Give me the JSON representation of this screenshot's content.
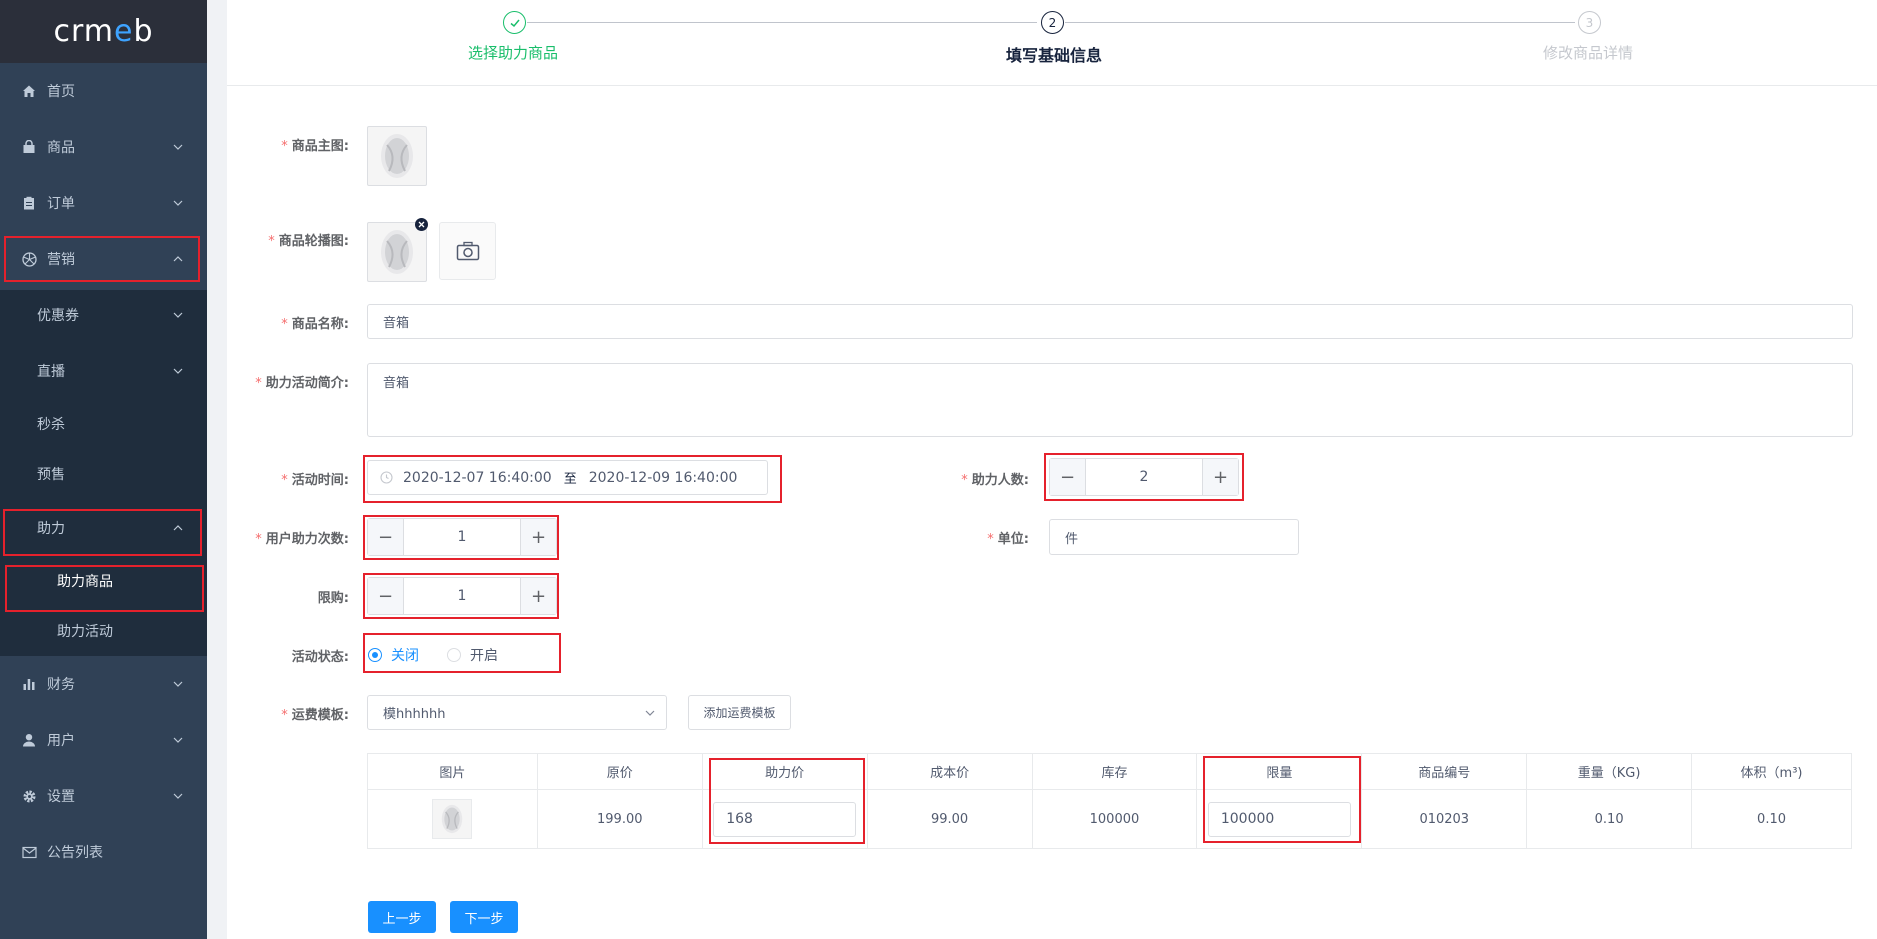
{
  "logo": {
    "pre": "crm",
    "e": "e",
    "post": "b"
  },
  "sidebar": {
    "items": [
      {
        "label": "首页",
        "icon": "home-icon"
      },
      {
        "label": "商品",
        "icon": "shopping-bag-icon"
      },
      {
        "label": "订单",
        "icon": "clipboard-icon"
      },
      {
        "label": "营销",
        "icon": "aperture-icon"
      },
      {
        "label": "财务",
        "icon": "bar-chart-icon"
      },
      {
        "label": "用户",
        "icon": "user-icon"
      },
      {
        "label": "设置",
        "icon": "gear-icon"
      },
      {
        "label": "公告列表",
        "icon": "mail-icon"
      }
    ],
    "marketing_sub": [
      {
        "label": "优惠券"
      },
      {
        "label": "直播"
      },
      {
        "label": "秒杀"
      },
      {
        "label": "预售"
      },
      {
        "label": "助力"
      }
    ],
    "assist_sub": [
      {
        "label": "助力商品"
      },
      {
        "label": "助力活动"
      }
    ]
  },
  "steps": [
    {
      "label": "选择助力商品",
      "num": "1",
      "status": "done"
    },
    {
      "label": "填写基础信息",
      "num": "2",
      "status": "active"
    },
    {
      "label": "修改商品详情",
      "num": "3",
      "status": "pending"
    }
  ],
  "form": {
    "main_image_label": "商品主图:",
    "carousel_label": "商品轮播图:",
    "name_label": "商品名称:",
    "name_value": "音箱",
    "intro_label": "助力活动简介:",
    "intro_value": "音箱",
    "time_label": "活动时间:",
    "time_start": "2020-12-07 16:40:00",
    "time_sep": "至",
    "time_end": "2020-12-09 16:40:00",
    "assist_people_label": "助力人数:",
    "assist_people_value": "2",
    "user_assist_label": "用户助力次数:",
    "user_assist_value": "1",
    "unit_label": "单位:",
    "unit_value": "件",
    "limit_label": "限购:",
    "limit_value": "1",
    "status_label": "活动状态:",
    "status_off": "关闭",
    "status_on": "开启",
    "status_selected": "关闭",
    "shipping_label": "运费模板:",
    "shipping_value": "模hhhhhh",
    "add_shipping_button": "添加运费模板"
  },
  "table": {
    "headers": [
      "图片",
      "原价",
      "助力价",
      "成本价",
      "库存",
      "限量",
      "商品编号",
      "重量（KG)",
      "体积（m³)"
    ],
    "row": {
      "original_price": "199.00",
      "assist_price": "168",
      "cost_price": "99.00",
      "stock": "100000",
      "limit": "100000",
      "sku": "010203",
      "weight": "0.10",
      "volume": "0.10"
    }
  },
  "buttons": {
    "prev": "上一步",
    "next": "下一步"
  },
  "colors": {
    "sidebar_bg": "#304156",
    "primary": "#1890ff",
    "success": "#19be6b",
    "highlight": "#e5212c"
  }
}
